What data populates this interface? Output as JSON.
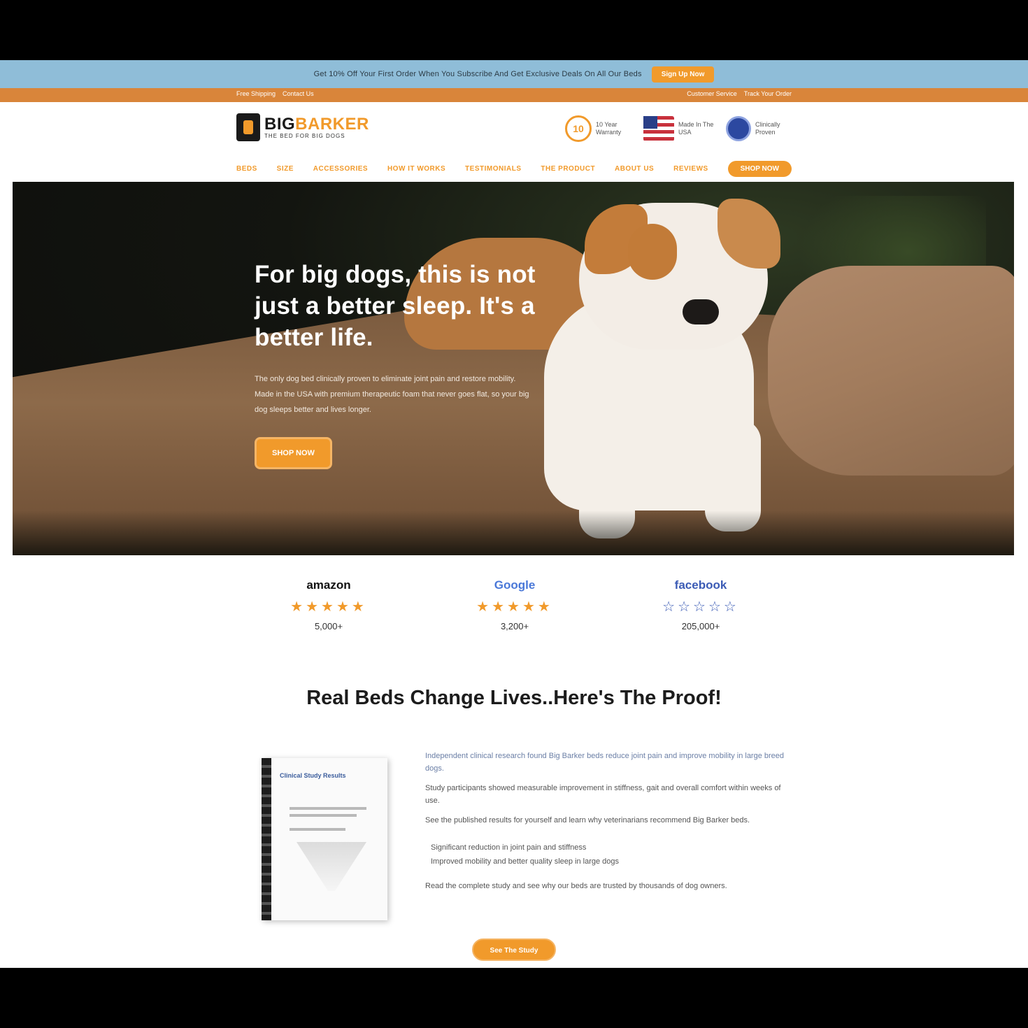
{
  "promo": {
    "text": "Get 10% Off Your First Order When You Subscribe And Get Exclusive Deals On All Our Beds",
    "button_label": "Sign Up Now"
  },
  "utility": {
    "left": [
      "Free Shipping",
      "Contact Us"
    ],
    "right": [
      "Customer Service",
      "Track Your Order"
    ]
  },
  "header": {
    "logo_name_main": "BIG",
    "logo_name_accent": "BARKER",
    "logo_tagline": "THE BED FOR BIG DOGS",
    "badges": [
      {
        "icon": "warranty-icon",
        "label": "10 Year Warranty"
      },
      {
        "icon": "usa-flag-icon",
        "label": "Made In The USA"
      },
      {
        "icon": "globe-icon",
        "label": "Clinically Proven"
      }
    ]
  },
  "nav": {
    "items": [
      "BEDS",
      "SIZE",
      "ACCESSORIES",
      "HOW IT WORKS",
      "TESTIMONIALS",
      "THE PRODUCT",
      "ABOUT US",
      "REVIEWS"
    ],
    "cta_label": "SHOP NOW"
  },
  "hero": {
    "title": "For big dogs, this is not just a better sleep. It's a better life.",
    "subtitle": "The only dog bed clinically proven to eliminate joint pain and restore mobility. Made in the USA with premium therapeutic foam that never goes flat, so your big dog sleeps better and lives longer.",
    "button_label": "SHOP NOW"
  },
  "ratings": [
    {
      "brand": "amazon",
      "stars": "★★★★★",
      "count": "5,000+",
      "star_color": "#f19a2b"
    },
    {
      "brand": "Google",
      "stars": "★★★★★",
      "count": "3,200+",
      "star_color": "#f19a2b"
    },
    {
      "brand": "facebook",
      "stars": "☆☆☆☆☆",
      "count": "205,000+",
      "star_color": "#3b5bb5"
    }
  ],
  "proof": {
    "heading": "Real Beds Change Lives..Here's The Proof!",
    "book_title": "Clinical Study Results",
    "paragraphs": [
      "Independent clinical research found Big Barker beds reduce joint pain and improve mobility in large breed dogs.",
      "Study participants showed measurable improvement in stiffness, gait and overall comfort within weeks of use.",
      "See the published results for yourself and learn why veterinarians recommend Big Barker beds."
    ],
    "bullets": [
      "Significant reduction in joint pain and stiffness",
      "Improved mobility and better quality sleep in large dogs"
    ],
    "closing": "Read the complete study and see why our beds are trusted by thousands of dog owners.",
    "button_label": "See The Study"
  }
}
